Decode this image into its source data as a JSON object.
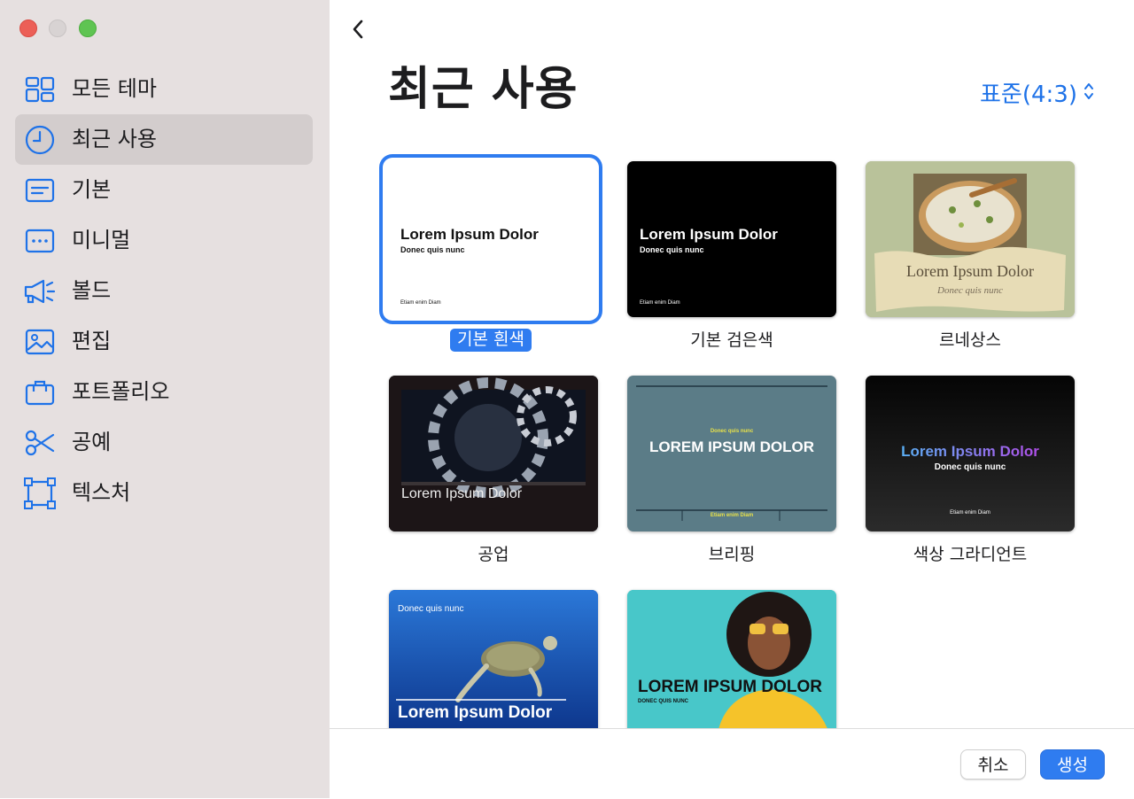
{
  "window": {
    "controls": [
      "close",
      "minimize",
      "maximize"
    ]
  },
  "sidebar": {
    "items": [
      {
        "label": "모든 테마",
        "icon": "themes-grid-icon"
      },
      {
        "label": "최근 사용",
        "icon": "clock-icon",
        "active": true
      },
      {
        "label": "기본",
        "icon": "basic-lines-icon"
      },
      {
        "label": "미니멀",
        "icon": "minimal-dots-icon"
      },
      {
        "label": "볼드",
        "icon": "megaphone-icon"
      },
      {
        "label": "편집",
        "icon": "photo-icon"
      },
      {
        "label": "포트폴리오",
        "icon": "briefcase-icon"
      },
      {
        "label": "공예",
        "icon": "scissors-icon"
      },
      {
        "label": "텍스처",
        "icon": "texture-frame-icon"
      }
    ]
  },
  "header": {
    "back_icon": "chevron-left-icon",
    "title": "최근 사용",
    "ratio_label": "표준(4:3)",
    "ratio_icon": "chevron-up-down-icon"
  },
  "themes": [
    {
      "name": "기본 흰색",
      "selected": true,
      "title": "Lorem Ipsum Dolor",
      "subtitle": "Donec quis nunc",
      "footer": "Etiam enim Diam"
    },
    {
      "name": "기본 검은색",
      "title": "Lorem Ipsum Dolor",
      "subtitle": "Donec quis nunc",
      "footer": "Etiam enim Diam"
    },
    {
      "name": "르네상스",
      "title": "Lorem Ipsum Dolor",
      "subtitle": "Donec quis nunc"
    },
    {
      "name": "공업",
      "title": "Lorem Ipsum Dolor"
    },
    {
      "name": "브리핑",
      "title": "LOREM IPSUM DOLOR",
      "subtitle": "Donec quis nunc",
      "footer": "Etiam enim Diam"
    },
    {
      "name": "색상 그라디언트",
      "title": "Lorem Ipsum Dolor",
      "subtitle": "Donec quis nunc",
      "footer": "Etiam enim Diam"
    },
    {
      "name": "",
      "title": "Lorem Ipsum Dolor",
      "subtitle": "Donec quis nunc"
    },
    {
      "name": "",
      "title": "LOREM IPSUM DOLOR",
      "subtitle": "DONEC QUIS NUNC"
    }
  ],
  "footer": {
    "cancel_label": "취소",
    "create_label": "생성"
  },
  "colors": {
    "accent": "#2f7cf0",
    "sidebar_bg": "#e6e0e0",
    "sidebar_active": "#d3cdcd",
    "icon_blue": "#1e72e8",
    "briefing_bg": "#5b7c87",
    "briefing_yellow": "#e6e04a",
    "renaissance_bg": "#b9c29a",
    "gradient_start": "#5ab0f5",
    "gradient_end": "#b04ee8",
    "turtle_sea": "#1747a8",
    "bold_photo_bg": "#48c7c9"
  }
}
